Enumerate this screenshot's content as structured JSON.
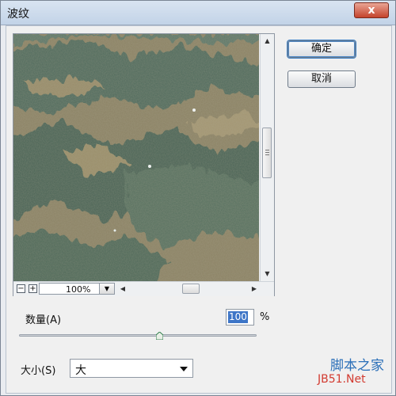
{
  "window": {
    "title": "波纹",
    "close_label": "x"
  },
  "buttons": {
    "ok_label": "确定",
    "cancel_label": "取消"
  },
  "preview": {
    "zoom_minus": "−",
    "zoom_plus": "+",
    "zoom_value": "100%"
  },
  "amount": {
    "label": "数量(A)",
    "value": "100",
    "unit": "%",
    "slider_fraction": 0.59
  },
  "size": {
    "label": "大小(S)",
    "selected": "大"
  },
  "watermark": {
    "line1": "脚本之家",
    "line2": "JB51.Net"
  },
  "colors": {
    "water_green": "#4e6a5c",
    "sand": "#8c8262",
    "selection_blue": "#3d75c7"
  }
}
